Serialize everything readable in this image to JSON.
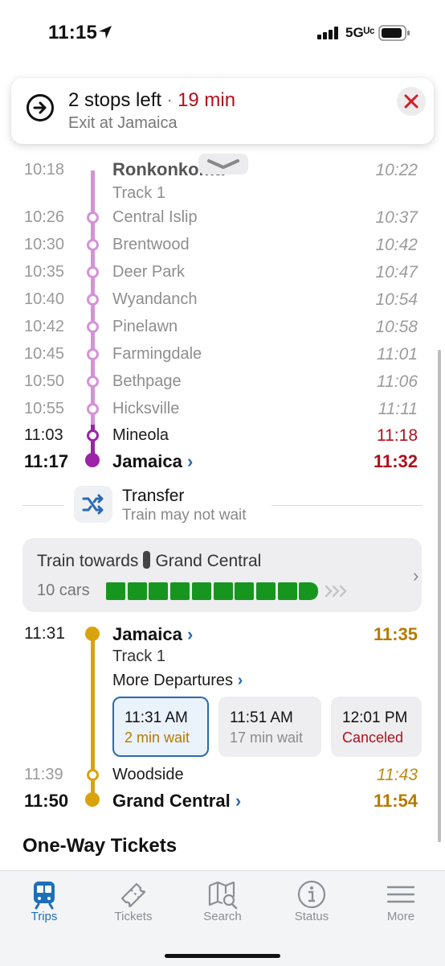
{
  "status_bar": {
    "time": "11:15",
    "network": "5Gᵁᶜ"
  },
  "trip_banner": {
    "title": "2 stops left",
    "minutes": "19 min",
    "subtitle": "Exit at Jamaica"
  },
  "stops_first_leg": [
    {
      "time": "10:18",
      "station": "Ronkonkoma",
      "arrive": "10:22",
      "track": "Track 1"
    },
    {
      "time": "10:26",
      "station": "Central Islip",
      "arrive": "10:37"
    },
    {
      "time": "10:30",
      "station": "Brentwood",
      "arrive": "10:42"
    },
    {
      "time": "10:35",
      "station": "Deer Park",
      "arrive": "10:47"
    },
    {
      "time": "10:40",
      "station": "Wyandanch",
      "arrive": "10:54"
    },
    {
      "time": "10:42",
      "station": "Pinelawn",
      "arrive": "10:58"
    },
    {
      "time": "10:45",
      "station": "Farmingdale",
      "arrive": "11:01"
    },
    {
      "time": "10:50",
      "station": "Bethpage",
      "arrive": "11:06"
    },
    {
      "time": "10:55",
      "station": "Hicksville",
      "arrive": "11:11"
    },
    {
      "time": "11:03",
      "station": "Mineola",
      "arrive": "11:18"
    },
    {
      "time": "11:17",
      "station": "Jamaica",
      "arrive": "11:32"
    }
  ],
  "transfer": {
    "title": "Transfer",
    "subtitle": "Train may not wait"
  },
  "train_info": {
    "prefix": "Train towards",
    "destination": "Grand Central",
    "cars_label": "10 cars",
    "cars": 10
  },
  "second_leg": {
    "start": {
      "time": "11:31",
      "station": "Jamaica",
      "arrive": "11:35",
      "track": "Track 1"
    },
    "more_departures": "More Departures",
    "departures": [
      {
        "time": "11:31 AM",
        "note": "2 min wait"
      },
      {
        "time": "11:51 AM",
        "note": "17 min wait"
      },
      {
        "time": "12:01 PM",
        "note": "Canceled"
      }
    ],
    "mid": {
      "time": "11:39",
      "station": "Woodside",
      "arrive": "11:43"
    },
    "end": {
      "time": "11:50",
      "station": "Grand Central",
      "arrive": "11:54"
    }
  },
  "tickets_heading": "One-Way Tickets",
  "tabs": [
    {
      "label": "Trips",
      "icon": "train-icon",
      "active": true
    },
    {
      "label": "Tickets",
      "icon": "ticket-icon"
    },
    {
      "label": "Search",
      "icon": "map-search-icon"
    },
    {
      "label": "Status",
      "icon": "info-icon"
    },
    {
      "label": "More",
      "icon": "menu-icon"
    }
  ],
  "colors": {
    "line_purple": "#d592d8",
    "line_purple_dark": "#9b24a8",
    "line_gold": "#d9a30e",
    "alert_red": "#b0101a",
    "time_gold": "#b67a00",
    "accent_blue": "#1e6fb8",
    "car_green": "#17961f"
  }
}
